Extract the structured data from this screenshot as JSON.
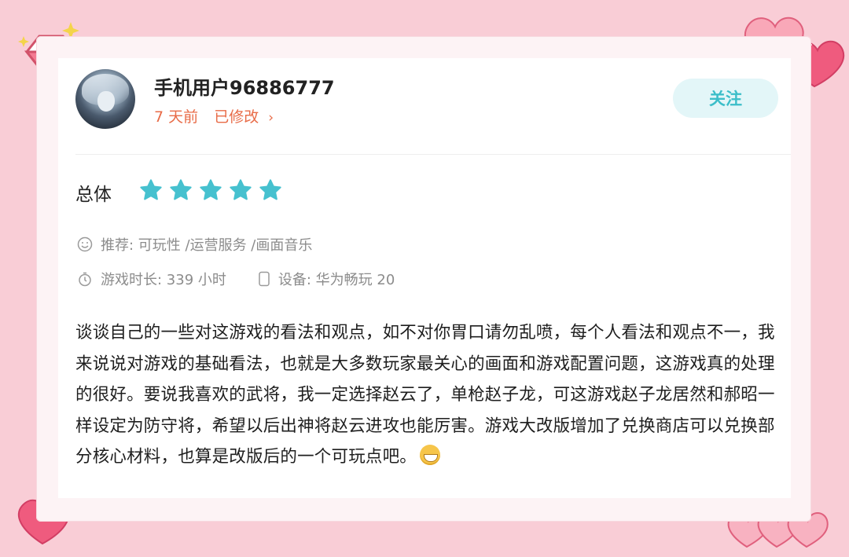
{
  "user": {
    "name": "手机用户96886777",
    "time": "7 天前",
    "edited": "已修改",
    "edited_chevron": "›"
  },
  "follow_button": {
    "label": "关注"
  },
  "rating": {
    "label": "总体",
    "stars": 5,
    "max": 5,
    "star_color": "#46c1cf"
  },
  "recommend": {
    "text": "推荐: 可玩性 /运营服务 /画面音乐",
    "icon": "smile-icon"
  },
  "playtime": {
    "text": "游戏时长: 339 小时",
    "icon": "stopwatch-icon"
  },
  "device": {
    "text": "设备: 华为畅玩 20",
    "icon": "phone-icon"
  },
  "review": {
    "text": "谈谈自己的一些对这游戏的看法和观点，如不对你胃口请勿乱喷，每个人看法和观点不一，我来说说对游戏的基础看法，也就是大多数玩家最关心的画面和游戏配置问题，这游戏真的处理的很好。要说我喜欢的武将，我一定选择赵云了，单枪赵子龙，可这游戏赵子龙居然和郝昭一样设定为防守将，希望以后出神将赵云进攻也能厉害。游戏大改版增加了兑换商店可以兑换部分核心材料，也算是改版后的一个可玩点吧。",
    "emoji": "grin-emoji"
  },
  "colors": {
    "background": "#f9cdd6",
    "accent_orange": "#e86b47",
    "accent_teal": "#3bbec9"
  }
}
